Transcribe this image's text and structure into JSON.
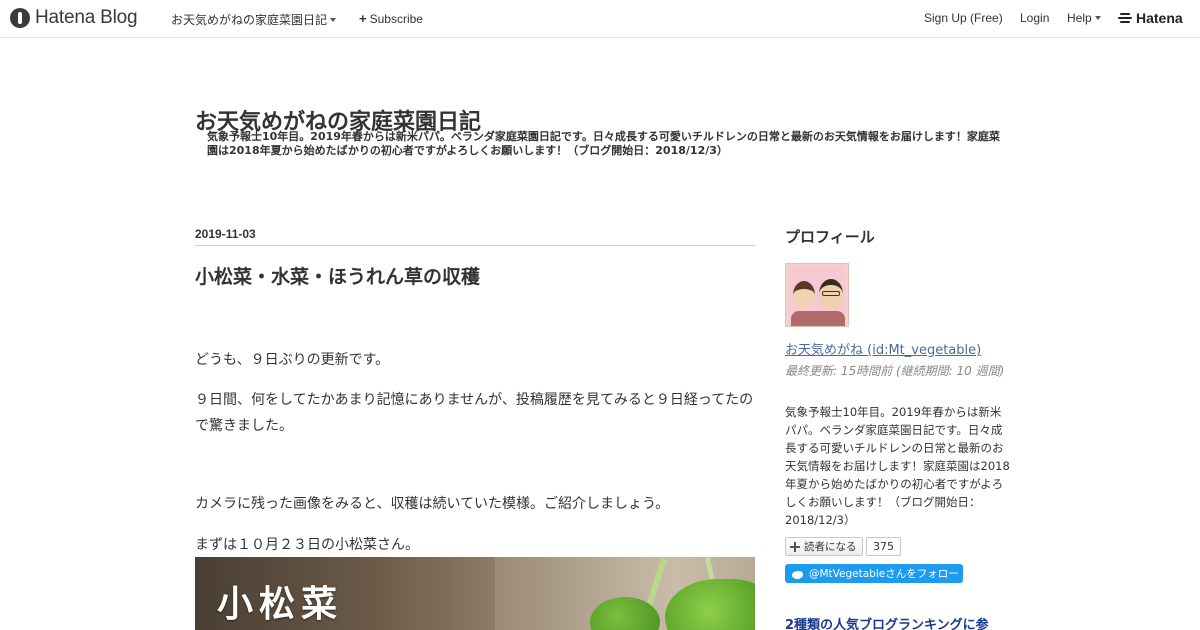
{
  "topbar": {
    "logo_text": "Hatena Blog",
    "blog_menu": "お天気めがねの家庭菜園日記",
    "subscribe": "Subscribe",
    "signup": "Sign Up (Free)",
    "login": "Login",
    "help": "Help",
    "hatena": "Hatena"
  },
  "header": {
    "title": "お天気めがねの家庭菜園日記",
    "description": "気象予報士10年目。2019年春からは新米パパ。ベランダ家庭菜園日記です。日々成長する可愛いチルドレンの日常と最新のお天気情報をお届けします！家庭菜園は2018年夏から始めたばかりの初心者ですがよろしくお願いします！（ブログ開始日：2018/12/3）"
  },
  "entry": {
    "date": "2019-11-03",
    "title": "小松菜・水菜・ほうれん草の収穫",
    "paragraphs": [
      "どうも、９日ぶりの更新です。",
      "９日間、何をしてたかあまり記憶にありませんが、投稿履歴を見てみると９日経ってたので驚きました。",
      "カメラに残った画像をみると、収穫は続いていた模様。ご紹介しましょう。",
      "まずは１０月２３日の小松菜さん。"
    ],
    "image_caption": "小松菜"
  },
  "sidebar": {
    "profile_heading": "プロフィール",
    "profile_name": "お天気めがね (id:Mt_vegetable)",
    "last_updated": "最終更新: 15時間前 (継続期間: 10 週間)",
    "description": "気象予報士10年目。2019年春からは新米パパ。ベランダ家庭菜園日記です。日々成長する可愛いチルドレンの日常と最新のお天気情報をお届けします！家庭菜園は2018年夏から始めたばかりの初心者ですがよろしくお願いします！（ブログ開始日：2018/12/3）",
    "reader_button": "読者になる",
    "reader_count": "375",
    "twitter_follow": "@MtVegetableさんをフォロー",
    "ranking_heading": "2種類の人気ブログランキングに参"
  },
  "colors": {
    "link": "#466c9c",
    "twitter": "#1d9bf0",
    "ranking": "#1b3a8f"
  }
}
